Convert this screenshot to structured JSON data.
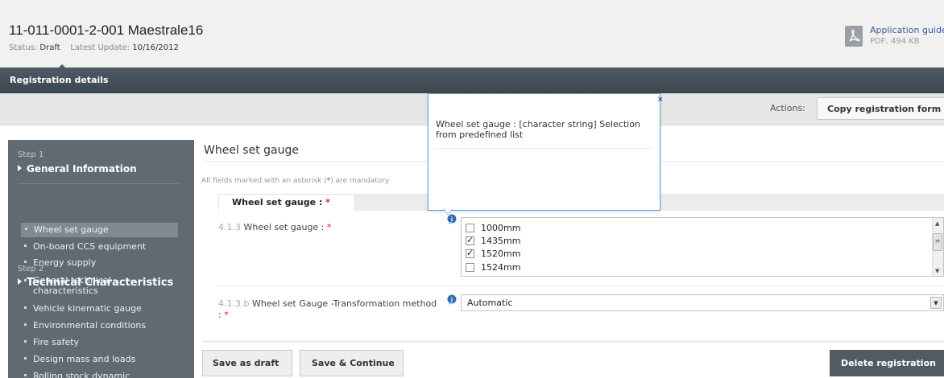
{
  "header": {
    "vehicle_code": "11-011-0001-2-001",
    "vehicle_name": "Maestrale16",
    "status_label": "Status:",
    "status_value": "Draft",
    "update_label": "Latest Update:",
    "update_value": "10/16/2012",
    "guide": {
      "icon": "pdf-icon",
      "title": "Application guide",
      "meta": "PDF, 494 KB"
    }
  },
  "tabs": {
    "active_label": "Registration details"
  },
  "actions": {
    "label": "Actions:",
    "copy_label": "Copy registration form"
  },
  "sidebar": {
    "step1": {
      "label": "Step 1",
      "title": "General Information"
    },
    "step2": {
      "label": "Step 2",
      "title": "Technical Characteristics"
    },
    "items": [
      {
        "label": "Wheel set gauge",
        "active": true
      },
      {
        "label": "On-board CCS equipment"
      },
      {
        "label": "Energy supply"
      },
      {
        "label": "General technical characteristics"
      },
      {
        "label": "Vehicle kinematic gauge"
      },
      {
        "label": "Environmental conditions"
      },
      {
        "label": "Fire safety"
      },
      {
        "label": "Design mass and loads"
      },
      {
        "label": "Rolling stock dynamic"
      }
    ]
  },
  "main": {
    "title": "Wheel set gauge",
    "mandatory_note_pre": "All fields marked with an asterisk (",
    "mandatory_note_star": "*",
    "mandatory_note_post": ") are mandatory",
    "section_tab": "Wheel set gauge :",
    "required_star": "*",
    "field1": {
      "number": "4.1.3",
      "label": "Wheel set gauge :",
      "options": [
        {
          "label": "1000mm",
          "checked": false
        },
        {
          "label": "1435mm",
          "checked": true
        },
        {
          "label": "1520mm",
          "checked": true
        },
        {
          "label": "1524mm",
          "checked": false
        }
      ]
    },
    "field2": {
      "number": "4.1.3.b",
      "label": "Wheel set Gauge -Transformation method",
      "label_cont": ":",
      "value": "Automatic"
    }
  },
  "tooltip": {
    "close": "×",
    "text": "Wheel set gauge : [character string] Selection from predefined list"
  },
  "buttons": {
    "save_draft": "Save as draft",
    "save_continue": "Save & Continue",
    "delete": "Delete registration"
  },
  "colors": {
    "dark_bar": "#4f5a63",
    "sidebar": "#5f6a73",
    "required": "#d0202e",
    "info": "#2f6db5",
    "link": "#3a5d8c"
  }
}
